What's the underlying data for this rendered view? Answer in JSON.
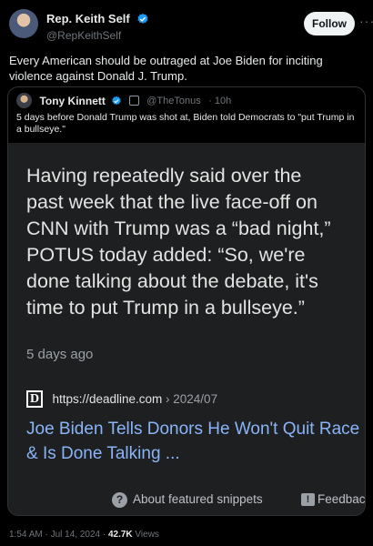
{
  "author": {
    "display_name": "Rep. Keith Self",
    "handle": "@RepKeithSelf",
    "verified_icon": "verified-badge-icon"
  },
  "follow_label": "Follow",
  "more_label": "···",
  "tweet_text": "Every American should be outraged at Joe Biden for inciting violence against Donald J. Trump.",
  "quoted": {
    "display_name": "Tony Kinnett",
    "handle": "@TheTonus",
    "age": "· 10h",
    "text": "5 days before Donald Trump was shot at, Biden told Democrats to \"put Trump in a bullseye.\"",
    "snippet": {
      "lines": [
        "Having repeatedly said over the",
        "past week that the live face-off on",
        "CNN with Trump was a “bad night,”",
        "POTUS today added: “So, we're",
        "done talking about the debate, it's",
        "time to put Trump in a bullseye.”"
      ],
      "age": "5 days ago",
      "source_logo": "D",
      "source_url": "https://deadline.com",
      "source_path": " › 2024/07",
      "result_title": "Joe Biden Tells Donors He Won't Quit Race & Is Done Talking ...",
      "about_label": "About featured snippets",
      "feedback_label": "Feedback"
    }
  },
  "meta": {
    "time": "1:54 AM · Jul 14, 2024 · ",
    "views_count": "42.7K",
    "views_label": " Views"
  },
  "colors": {
    "background": "#000000",
    "verified_blue": "#1d9bf0",
    "link_blue": "#8ab4f8",
    "snippet_bg": "#1e1f20"
  }
}
